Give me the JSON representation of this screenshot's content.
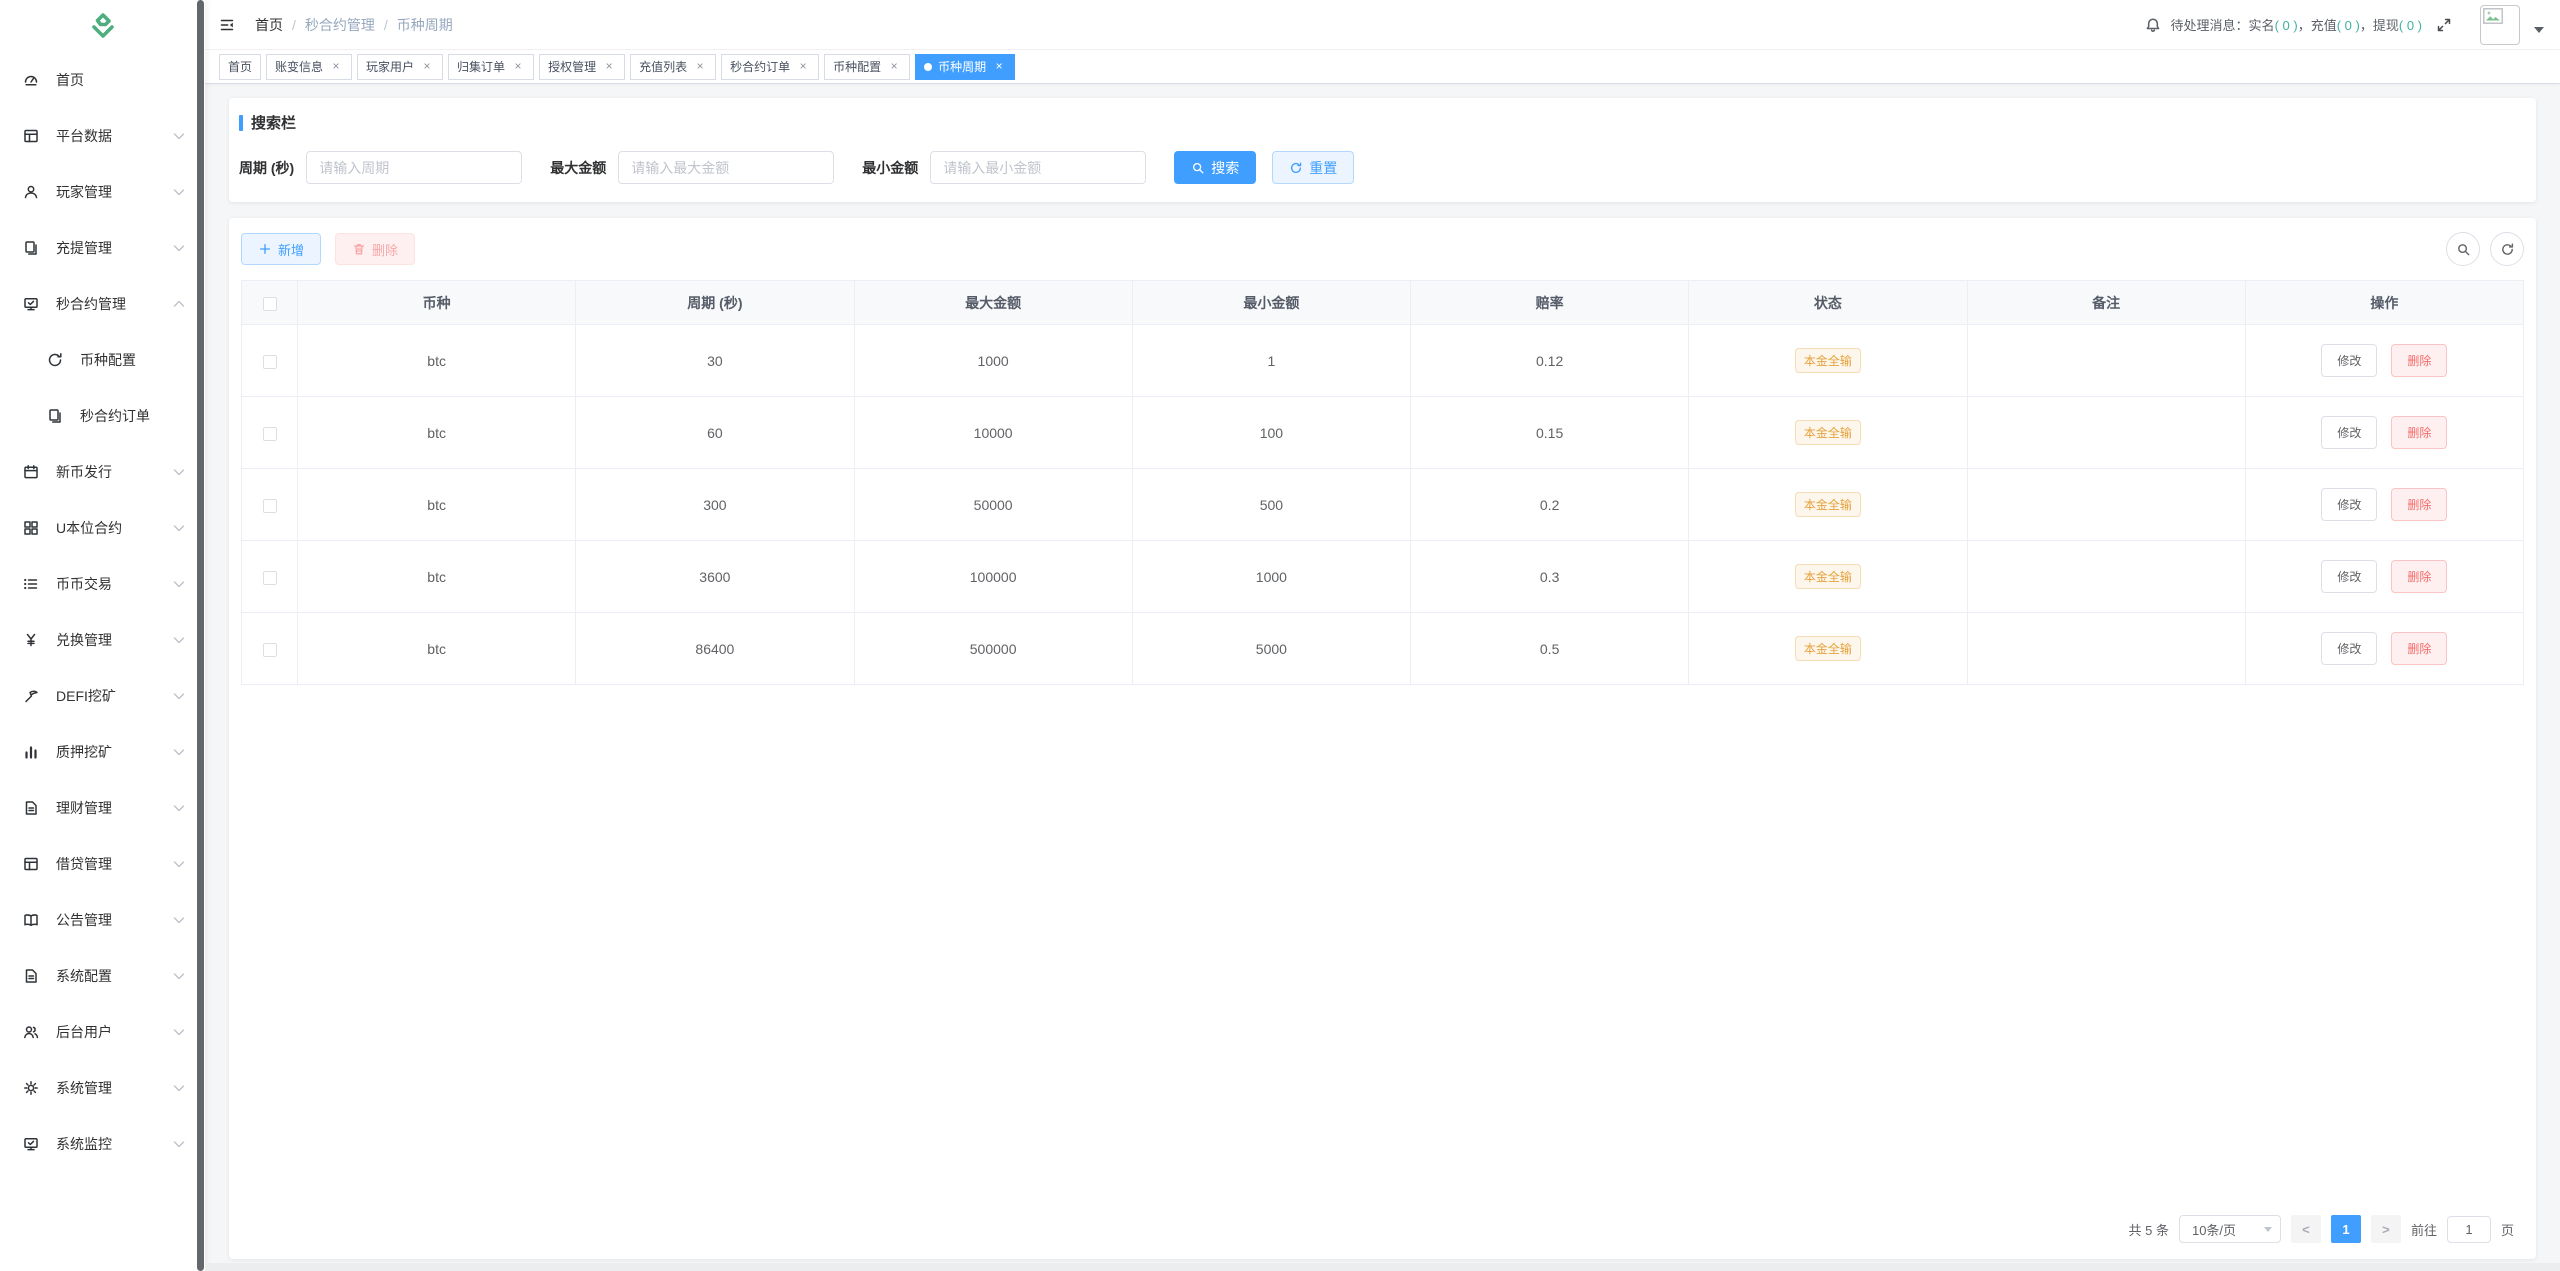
{
  "theme": {
    "accent": "#409eff",
    "warning": "#e6a23c",
    "danger": "#f56c6c",
    "count_teal": "#3fb3a3",
    "logo_green": "#4fae7f"
  },
  "sidebar": {
    "items": [
      {
        "label": "首页",
        "icon": "gauge-icon"
      },
      {
        "label": "平台数据",
        "icon": "spreadsheet-icon"
      },
      {
        "label": "玩家管理",
        "icon": "user-icon"
      },
      {
        "label": "充提管理",
        "icon": "copy-icon"
      },
      {
        "label": "秒合约管理",
        "icon": "monitor-check-icon",
        "expanded": true,
        "children": [
          {
            "label": "币种配置",
            "icon": "sync-icon"
          },
          {
            "label": "秒合约订单",
            "icon": "copy-icon"
          }
        ]
      },
      {
        "label": "新币发行",
        "icon": "calendar-icon"
      },
      {
        "label": "U本位合约",
        "icon": "grid-icon"
      },
      {
        "label": "币币交易",
        "icon": "list-icon"
      },
      {
        "label": "兑换管理",
        "icon": "yen-icon"
      },
      {
        "label": "DEFI挖矿",
        "icon": "mining-icon"
      },
      {
        "label": "质押挖矿",
        "icon": "bar-chart-icon"
      },
      {
        "label": "理财管理",
        "icon": "document-icon"
      },
      {
        "label": "借贷管理",
        "icon": "spreadsheet-icon"
      },
      {
        "label": "公告管理",
        "icon": "book-icon"
      },
      {
        "label": "系统配置",
        "icon": "document-icon"
      },
      {
        "label": "后台用户",
        "icon": "users-icon"
      },
      {
        "label": "系统管理",
        "icon": "gear-icon"
      },
      {
        "label": "系统监控",
        "icon": "monitor-check-icon"
      }
    ]
  },
  "navbar": {
    "breadcrumb": {
      "home": "首页",
      "sep": "/",
      "section": "秒合约管理",
      "current": "币种周期"
    },
    "message": {
      "prefix": "待处理消息：",
      "sep": "，",
      "items": [
        {
          "label": "实名",
          "count": "( 0 )"
        },
        {
          "label": "充值",
          "count": "( 0 )"
        },
        {
          "label": "提现",
          "count": "( 0 )"
        }
      ]
    }
  },
  "tabs": [
    {
      "label": "首页",
      "closable": false,
      "active": false
    },
    {
      "label": "账变信息",
      "closable": true,
      "active": false
    },
    {
      "label": "玩家用户",
      "closable": true,
      "active": false
    },
    {
      "label": "归集订单",
      "closable": true,
      "active": false
    },
    {
      "label": "授权管理",
      "closable": true,
      "active": false
    },
    {
      "label": "充值列表",
      "closable": true,
      "active": false
    },
    {
      "label": "秒合约订单",
      "closable": true,
      "active": false
    },
    {
      "label": "币种配置",
      "closable": true,
      "active": false
    },
    {
      "label": "币种周期",
      "closable": true,
      "active": true
    }
  ],
  "ui": {
    "close_glyph": "×",
    "prev_glyph": "<",
    "next_glyph": ">"
  },
  "search": {
    "title": "搜索栏",
    "fields": [
      {
        "label": "周期 (秒)",
        "placeholder": "请输入周期",
        "value": ""
      },
      {
        "label": "最大金额",
        "placeholder": "请输入最大金额",
        "value": ""
      },
      {
        "label": "最小金额",
        "placeholder": "请输入最小金额",
        "value": ""
      }
    ],
    "search_label": "搜索",
    "reset_label": "重置"
  },
  "toolbar": {
    "add_label": "新增",
    "delete_label": "删除"
  },
  "table": {
    "headers": [
      "币种",
      "周期 (秒)",
      "最大金额",
      "最小金额",
      "赔率",
      "状态",
      "备注",
      "操作"
    ],
    "edit_label": "修改",
    "delete_label": "删除",
    "rows": [
      {
        "coin": "btc",
        "period": "30",
        "max": "1000",
        "min": "1",
        "odds": "0.12",
        "status": "本金全输",
        "remark": ""
      },
      {
        "coin": "btc",
        "period": "60",
        "max": "10000",
        "min": "100",
        "odds": "0.15",
        "status": "本金全输",
        "remark": ""
      },
      {
        "coin": "btc",
        "period": "300",
        "max": "50000",
        "min": "500",
        "odds": "0.2",
        "status": "本金全输",
        "remark": ""
      },
      {
        "coin": "btc",
        "period": "3600",
        "max": "100000",
        "min": "1000",
        "odds": "0.3",
        "status": "本金全输",
        "remark": ""
      },
      {
        "coin": "btc",
        "period": "86400",
        "max": "500000",
        "min": "5000",
        "odds": "0.5",
        "status": "本金全输",
        "remark": ""
      }
    ]
  },
  "pagination": {
    "total": "共 5 条",
    "page_size": "10条/页",
    "current_page": "1",
    "goto_label": "前往",
    "goto_value": "1",
    "page_unit": "页"
  }
}
